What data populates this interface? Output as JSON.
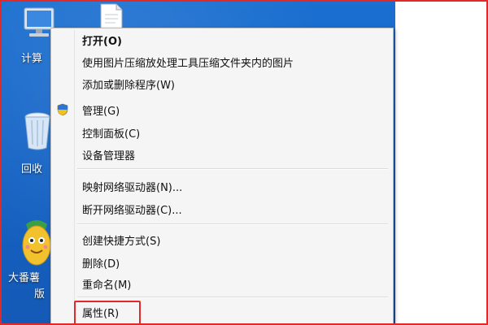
{
  "desktop": {
    "icons": [
      {
        "label": "计算",
        "icon": "computer-icon"
      },
      {
        "label": "回收",
        "icon": "recycle-bin-icon"
      },
      {
        "label": "大番薯",
        "label2": "版",
        "icon": "dafanshu-mascot-icon"
      }
    ],
    "file_icon": "file-icon"
  },
  "context_menu": {
    "items": [
      {
        "label": "打开(O)",
        "bold": true
      },
      {
        "label": "使用图片压缩放处理工具压缩文件夹内的图片"
      },
      {
        "label": "添加或删除程序(W)"
      },
      {
        "label": "管理(G)",
        "icon": "uac-shield-icon"
      },
      {
        "label": "控制面板(C)"
      },
      {
        "label": "设备管理器"
      },
      {
        "label": "映射网络驱动器(N)..."
      },
      {
        "label": "断开网络驱动器(C)..."
      },
      {
        "label": "创建快捷方式(S)"
      },
      {
        "label": "删除(D)"
      },
      {
        "label": "重命名(M)"
      },
      {
        "label": "属性(R)",
        "highlighted": true
      }
    ]
  },
  "colors": {
    "desktop_blue": "#1663c4",
    "highlight_red": "#e02a2a",
    "menu_bg": "#f5f5f5"
  }
}
